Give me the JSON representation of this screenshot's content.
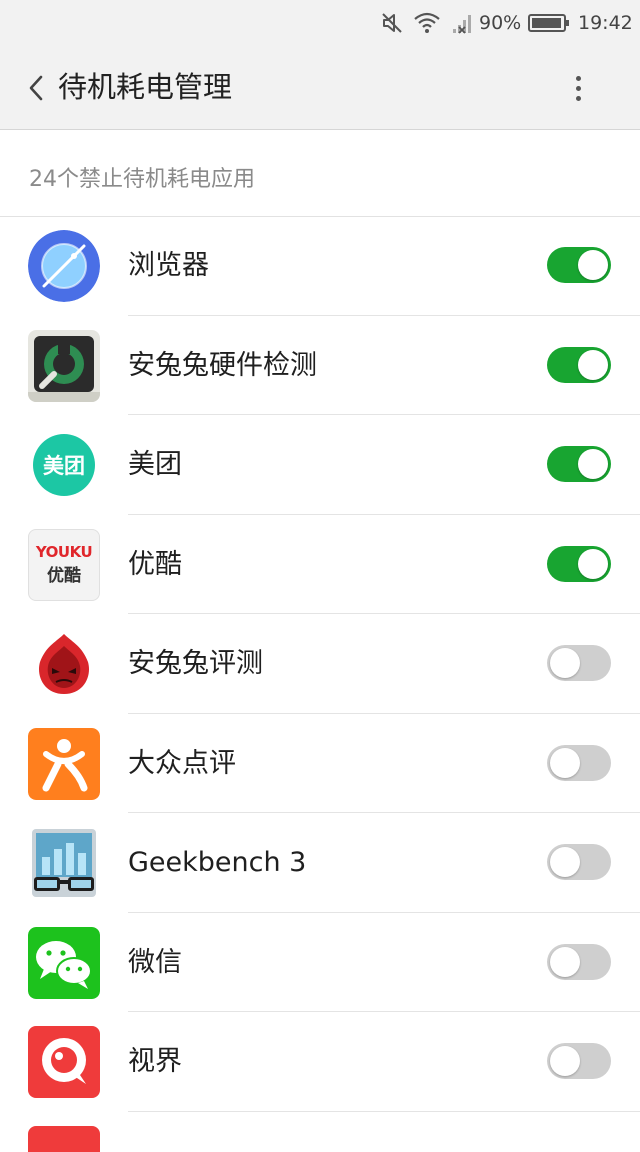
{
  "status_bar": {
    "battery": "90%",
    "time": "19:42",
    "icons": [
      "mute-icon",
      "wifi-icon",
      "signal-icon",
      "battery-icon"
    ]
  },
  "app_bar": {
    "title": "待机耗电管理",
    "back_icon": "chevron-left-icon",
    "menu_icon": "more-vertical-icon"
  },
  "section": {
    "header": "24个禁止待机耗电应用"
  },
  "apps": [
    {
      "name": "浏览器",
      "icon": "browser-icon",
      "enabled": true
    },
    {
      "name": "安兔兔硬件检测",
      "icon": "antutu-hardware-icon",
      "enabled": true
    },
    {
      "name": "美团",
      "icon": "meituan-icon",
      "icon_text": "美团",
      "enabled": true
    },
    {
      "name": "优酷",
      "icon": "youku-icon",
      "icon_text_top": "YOUKU",
      "icon_text_bottom": "优酷",
      "enabled": true
    },
    {
      "name": "安兔兔评测",
      "icon": "antutu-benchmark-icon",
      "enabled": false
    },
    {
      "name": "大众点评",
      "icon": "dianping-icon",
      "enabled": false
    },
    {
      "name": "Geekbench 3",
      "icon": "geekbench-icon",
      "enabled": false
    },
    {
      "name": "微信",
      "icon": "wechat-icon",
      "enabled": false
    },
    {
      "name": "视界",
      "icon": "shijie-icon",
      "enabled": false
    }
  ],
  "colors": {
    "toggle_on": "#18a531",
    "toggle_off": "#cfcfcf"
  }
}
